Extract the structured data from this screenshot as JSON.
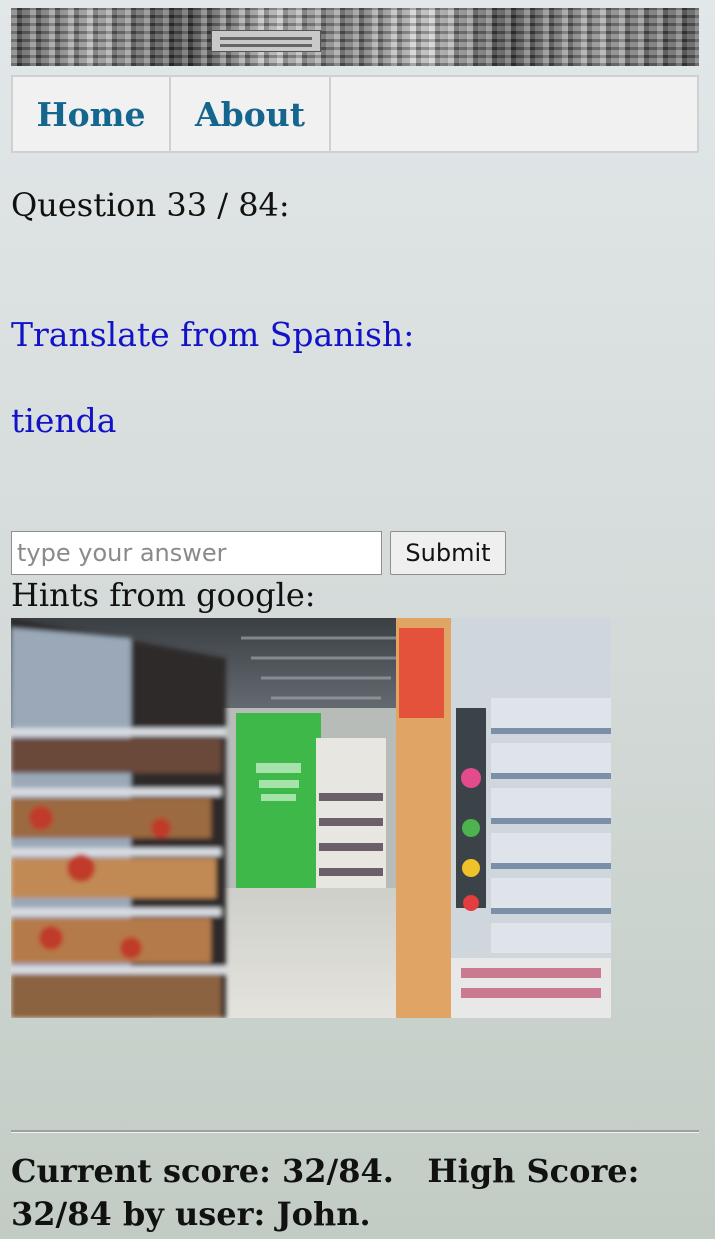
{
  "nav": {
    "home_label": "Home",
    "about_label": "About"
  },
  "quiz": {
    "question_counter": "Question 33 / 84:",
    "instruction": "Translate from Spanish:",
    "word": "tienda"
  },
  "answer_form": {
    "placeholder": "type your answer",
    "value": "",
    "submit_label": "Submit"
  },
  "hints": {
    "label": "Hints from google:",
    "image_description_icon": "store-aisle-photo"
  },
  "footer": {
    "score_text": "Current score: 32/84.   High Score: 32/84 by user: John."
  },
  "colors": {
    "nav_link": "#14668f",
    "prompt_text": "#1212c8",
    "background_top": "#e2e7e9",
    "background_bottom": "#c2ccc4"
  }
}
